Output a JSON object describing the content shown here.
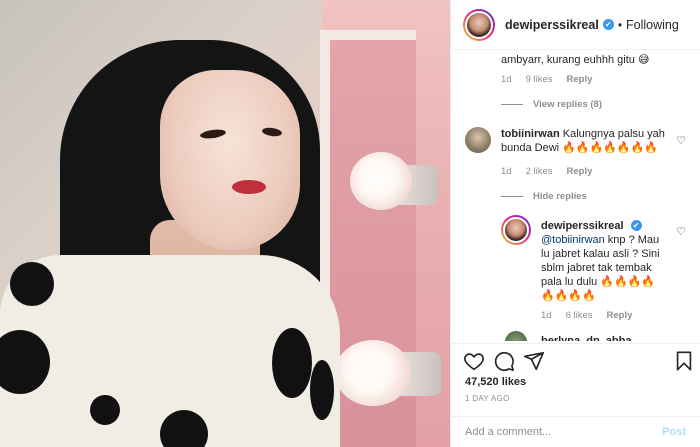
{
  "header": {
    "username": "dewiperssikreal",
    "verified_glyph": "✔",
    "separator": "•",
    "follow_state": "Following"
  },
  "comments": {
    "top_partial": {
      "text": "ambyarr, kurang euhhh gitu 😅",
      "age": "1d",
      "likes": "9 likes",
      "reply": "Reply",
      "view_replies": "View replies (8)"
    },
    "second": {
      "username": "tobiinirwan",
      "text": "Kalungnya palsu yah bunda Dewi 🔥🔥🔥🔥🔥🔥🔥",
      "age": "1d",
      "likes": "2 likes",
      "reply": "Reply",
      "hide_replies": "Hide replies"
    },
    "reply": {
      "username": "dewiperssikreal",
      "mention": "@tobiinirwan",
      "text": " knp ? Mau lu jabret kalau asli ? Sini sblm jabret tak tembak pala lu dulu 🔥🔥🔥🔥🔥🔥🔥🔥",
      "age": "1d",
      "likes": "6 likes",
      "reply": "Reply"
    },
    "partial_next": {
      "username": "berlyna_dn_abba"
    }
  },
  "actions": {
    "icons": [
      "heart-icon",
      "comment-icon",
      "share-icon",
      "bookmark-icon"
    ]
  },
  "stats": {
    "likes": "47,520 likes",
    "time": "1 DAY AGO"
  },
  "add_comment": {
    "placeholder": "Add a comment...",
    "post_label": "Post"
  },
  "colors": {
    "verified": "#3897f0",
    "link": "#00376b",
    "muted": "#8e8e8e",
    "post_disabled": "#b2dffc"
  }
}
